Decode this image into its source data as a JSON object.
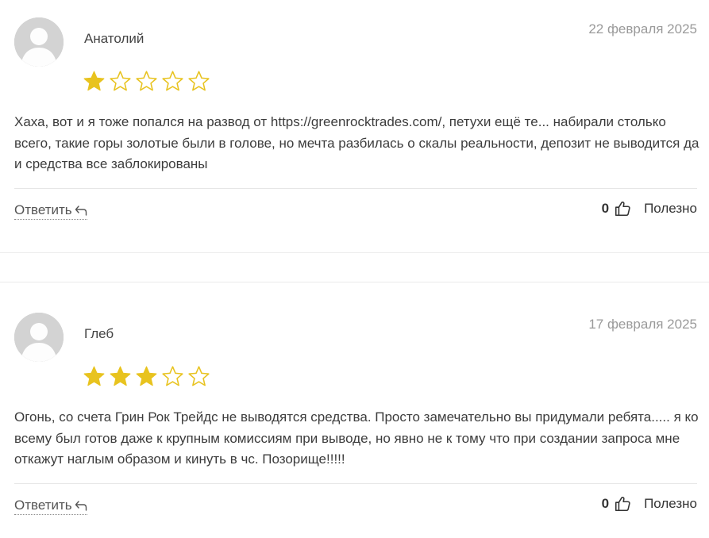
{
  "reviews": [
    {
      "author": "Анатолий",
      "date": "22 февраля 2025",
      "rating": 1,
      "max_rating": 5,
      "text": "Хаха, вот и я тоже попался на развод от https://greenrocktrades.com/, петухи ещё те... набирали столько всего, такие горы золотые были в голове, но мечта разбилась о скалы реальности, депозит не выводится да и средства все заблокированы",
      "reply_label": "Ответить",
      "votes": "0",
      "helpful_label": "Полезно"
    },
    {
      "author": "Глеб",
      "date": "17 февраля 2025",
      "rating": 3,
      "max_rating": 5,
      "text": "Огонь, со счета Грин Рок Трейдс не выводятся средства. Просто замечательно вы придумали ребята..... я ко всему был готов даже к крупным комиссиям при выводе, но явно не к тому что при создании запроса мне откажут наглым образом и кинуть в чс. Позорище!!!!!",
      "reply_label": "Ответить",
      "votes": "0",
      "helpful_label": "Полезно"
    }
  ],
  "colors": {
    "star_filled": "#e8c31f",
    "star_empty_stroke": "#e8c31f",
    "avatar_bg": "#d3d3d3",
    "avatar_figure": "#ffffff",
    "date_text": "#9a9a9a"
  },
  "icons": {
    "avatar": "user-placeholder-icon",
    "star_filled": "star-filled-icon",
    "star_empty": "star-outline-icon",
    "reply": "reply-arrow-icon",
    "like": "thumbs-up-icon"
  }
}
